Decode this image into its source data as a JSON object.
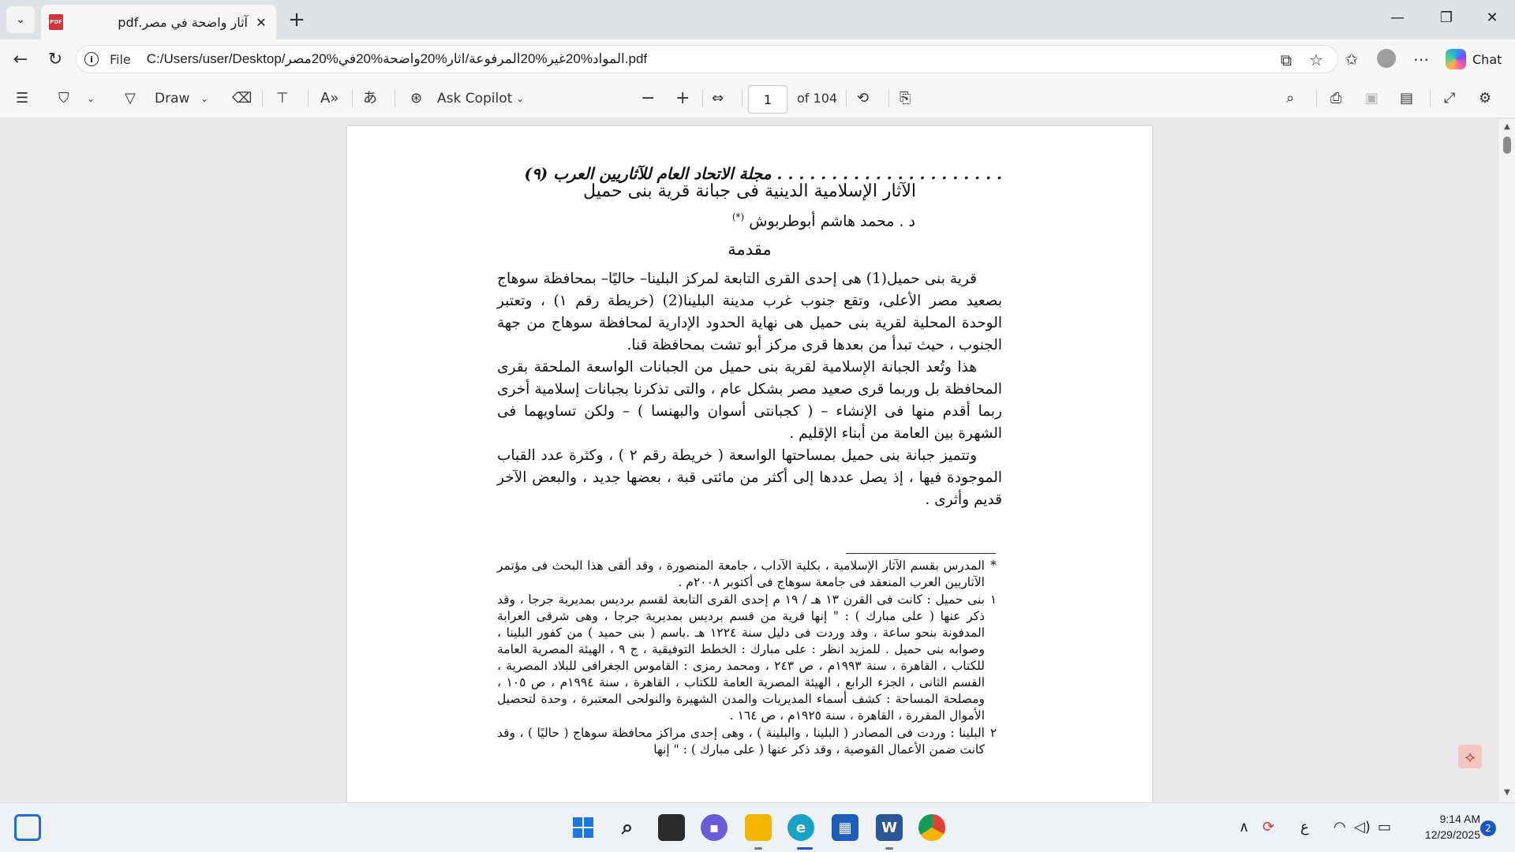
{
  "browser": {
    "tab": {
      "title": "آثار واضحة في مصر.pdf",
      "badge": "PDF"
    },
    "address": {
      "scheme": "File",
      "url": "C:/Users/user/Desktop/المواد%20غير%20المرفوعة/اثار%20واضحة%20في%20مصر.pdf"
    },
    "chat_label": "Chat"
  },
  "pdf_toolbar": {
    "draw_label": "Draw",
    "copilot_label": "Ask Copilot",
    "page_current": "1",
    "page_total": "of 104"
  },
  "document": {
    "journal_header": ". . . . . . . . . . . . . . . . . . . . . مجلة الاتحاد العام للآثاريين العرب (٩)",
    "title": "الآثار الإسلامية الدينية فى جبانة قرية بنى حميل",
    "author": "د . محمد هاشم أبوطربوش",
    "author_mark": "(*)",
    "intro_heading": "مقدمة",
    "paragraphs": [
      "قرية بنى حميل(1) هى إحدى القرى التابعة لمركز البلينا– حاليًا– بمحافظة سوهاج بصعيد مصر الأعلى، وتقع جنوب غرب مدينة البلينا(2) (خريطة رقم ١) ، وتعتبر الوحدة المحلية لقرية بنى حميل هى نهاية الحدود الإدارية لمحافظة سوهاج من جهة الجنوب ، حيث تبدأ من بعدها قرى مركز أبو تشت بمحافظة قنا.",
      "هذا وتُعد الجبانة الإسلامية لقرية بنى حميل من الجبانات الواسعة الملحقة بقرى المحافظة بل وربما قرى صعيد مصر بشكل عام ، والتى تذكرنا بجبانات إسلامية أخرى ربما أقدم منها فى الإنشاء – ( كجبانتى أسوان والبهنسا ) – ولكن تساويهما فى الشهرة بين العامة من أبناء الإقليم .",
      "وتتميز جبانة بنى حميل بمساحتها الواسعة ( خريطة رقم ٢ ) ، وكثرة عدد القباب الموجودة فيها ، إذ يصل عددها إلى أكثر من مائتى قبة ، بعضها جديد ، والبعض الآخر قديم وأثرى ."
    ],
    "footnotes": [
      {
        "mark": "*",
        "text": "المدرس بقسم الآثار الإسلامية ، بكلية الآداب ، جامعة المنصورة ، وقد ألقى هذا البحث فى مؤتمر الآثاريين العرب المنعقد فى جامعة سوهاج فى أكتوبر ٢٠٠٨م ."
      },
      {
        "mark": "١",
        "text": "بنى حميل : كانت فى القرن ١٣ هـ / ١٩ م إحدى القرى التابعة لقسم برديس بمديرية جرجا ، وقد ذكر عنها ( على مبارك ) : \" إنها قرية من قسم برديس بمديرية جرجا ، وهى شرقى العرابة المدفونة بنحو ساعة ، وقد وردت فى دليل سنة ١٢٢٤ هـ .باسم ( بنى حميد ) من كفور البلينا ، وصوابه بنى حميل . للمزيد انظر : على مبارك : الخطط التوفيقية ، ج ٩ ، الهيئة المصرية العامة للكتاب ، القاهرة ، سنة ١٩٩٣م ، ص ٢٤٣ ، ومحمد رمزى : القاموس الجغرافى للبلاد المصرية ، القسم الثانى ، الجزء الرابع ، الهيئة المصرية العامة للكتاب ، القاهرة ، سنة ١٩٩٤م ، ص ١٠٥ ، ومصلحة المساحة : كشف أسماء المديريات والمدن الشهيرة والنولحى المعتبرة ، وحدة لتحصيل الأموال المقررة ، القاهرة ، سنة ١٩٢٥م ، ص ١٦٤ ."
      },
      {
        "mark": "٢",
        "text": "البلينا : وردت فى المصادر ( البلينا ، والبلينة ) ، وهى إحدى مراكز محافظة سوهاج ( حاليًا ) ، وقد كانت ضمن الأعمال القوصية ، وقد ذكر عنها ( على مبارك ) : \" إنها"
      }
    ]
  },
  "taskbar": {
    "input_language": "ع",
    "time": "9:14 AM",
    "date": "12/29/2025",
    "notifications": "2"
  }
}
